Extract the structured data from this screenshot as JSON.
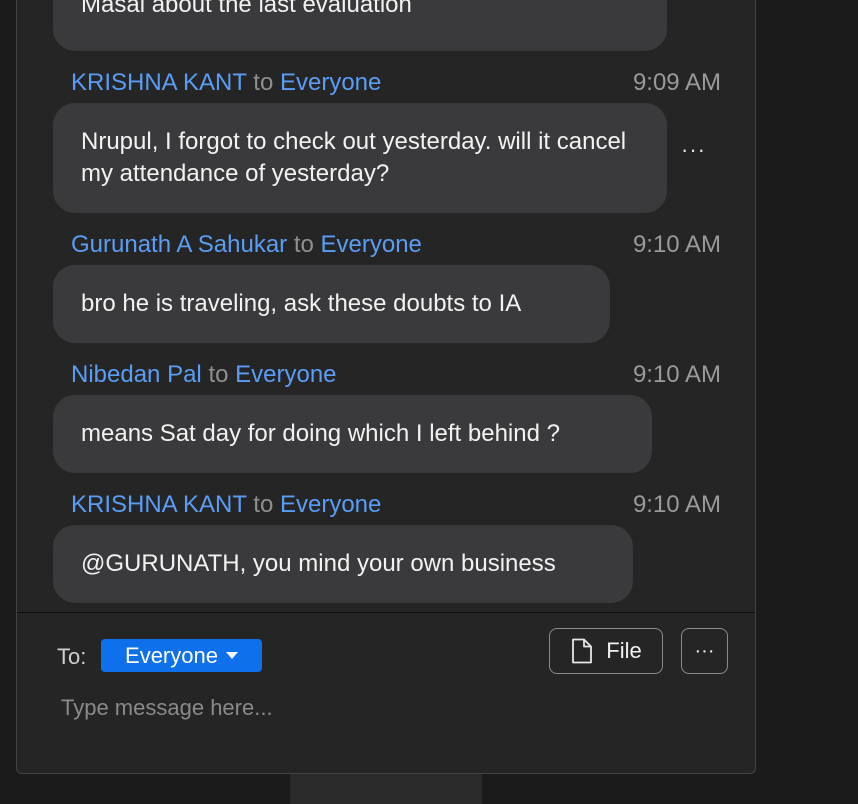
{
  "messages": [
    {
      "sender": "",
      "to_word": "",
      "recipient": "",
      "time": "",
      "text": "Masai about the last evaluation"
    },
    {
      "sender": "KRISHNA KANT",
      "to_word": "to",
      "recipient": "Everyone",
      "time": "9:09 AM",
      "text": "Nrupul, I forgot to check out yesterday. will it cancel my attendance of yesterday?",
      "more_icon": "ellipsis-icon",
      "more_label": "···"
    },
    {
      "sender": "Gurunath A Sahukar",
      "to_word": "to",
      "recipient": "Everyone",
      "time": "9:10 AM",
      "text": "bro he is traveling, ask these doubts to IA"
    },
    {
      "sender": "Nibedan Pal",
      "to_word": "to",
      "recipient": "Everyone",
      "time": "9:10 AM",
      "text": "means Sat day for doing which I left behind ?"
    },
    {
      "sender": "KRISHNA KANT",
      "to_word": "to",
      "recipient": "Everyone",
      "time": "9:10 AM",
      "text": "@GURUNATH, you mind your own business"
    }
  ],
  "composer": {
    "to_label": "To:",
    "recipient_selected": "Everyone",
    "file_label": "File",
    "file_icon": "file-icon",
    "more_icon": "ellipsis-icon",
    "more_label": "···",
    "input_placeholder": "Type message here...",
    "input_value": ""
  },
  "colors": {
    "panel_bg": "#252526",
    "bubble_bg": "#3a3a3c",
    "name_blue": "#5a9df5",
    "accent": "#0e71eb"
  }
}
